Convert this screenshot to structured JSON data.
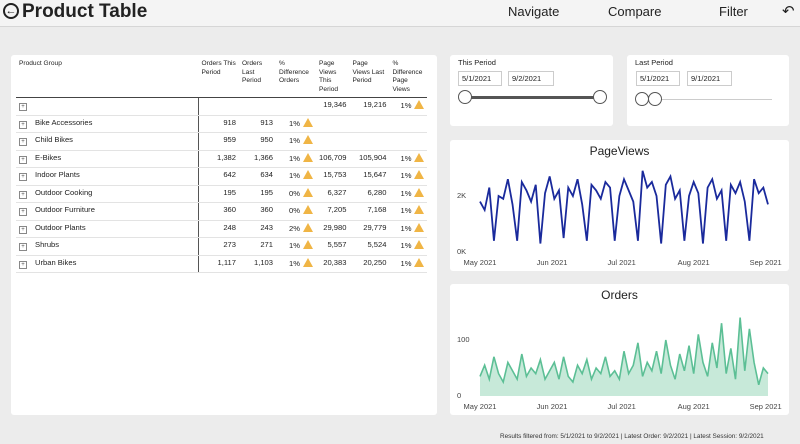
{
  "header": {
    "back_icon": "back-arrow-circle-icon",
    "title": "Product Table",
    "nav": [
      "Navigate",
      "Compare",
      "Filter"
    ],
    "undo_icon": "undo-arrow-icon"
  },
  "table": {
    "headers": [
      "Product Group",
      "Orders This Period",
      "Orders Last Period",
      "% Difference Orders",
      "Page Views This Period",
      "Page Views Last Period",
      "% Difference Page Views"
    ],
    "rows": [
      {
        "name": "",
        "o_this": "",
        "o_last": "",
        "o_diff": "",
        "o_warn": false,
        "pv_this": "19,346",
        "pv_last": "19,216",
        "pv_diff": "1%",
        "pv_warn": true
      },
      {
        "name": "Bike Accessories",
        "o_this": "918",
        "o_last": "913",
        "o_diff": "1%",
        "o_warn": true,
        "pv_this": "",
        "pv_last": "",
        "pv_diff": "",
        "pv_warn": false
      },
      {
        "name": "Child Bikes",
        "o_this": "959",
        "o_last": "950",
        "o_diff": "1%",
        "o_warn": true,
        "pv_this": "",
        "pv_last": "",
        "pv_diff": "",
        "pv_warn": false
      },
      {
        "name": "E-Bikes",
        "o_this": "1,382",
        "o_last": "1,366",
        "o_diff": "1%",
        "o_warn": true,
        "pv_this": "106,709",
        "pv_last": "105,904",
        "pv_diff": "1%",
        "pv_warn": true
      },
      {
        "name": "Indoor Plants",
        "o_this": "642",
        "o_last": "634",
        "o_diff": "1%",
        "o_warn": true,
        "pv_this": "15,753",
        "pv_last": "15,647",
        "pv_diff": "1%",
        "pv_warn": true
      },
      {
        "name": "Outdoor Cooking",
        "o_this": "195",
        "o_last": "195",
        "o_diff": "0%",
        "o_warn": true,
        "pv_this": "6,327",
        "pv_last": "6,280",
        "pv_diff": "1%",
        "pv_warn": true
      },
      {
        "name": "Outdoor Furniture",
        "o_this": "360",
        "o_last": "360",
        "o_diff": "0%",
        "o_warn": true,
        "pv_this": "7,205",
        "pv_last": "7,168",
        "pv_diff": "1%",
        "pv_warn": true
      },
      {
        "name": "Outdoor Plants",
        "o_this": "248",
        "o_last": "243",
        "o_diff": "2%",
        "o_warn": true,
        "pv_this": "29,980",
        "pv_last": "29,779",
        "pv_diff": "1%",
        "pv_warn": true
      },
      {
        "name": "Shrubs",
        "o_this": "273",
        "o_last": "271",
        "o_diff": "1%",
        "o_warn": true,
        "pv_this": "5,557",
        "pv_last": "5,524",
        "pv_diff": "1%",
        "pv_warn": true
      },
      {
        "name": "Urban Bikes",
        "o_this": "1,117",
        "o_last": "1,103",
        "o_diff": "1%",
        "o_warn": true,
        "pv_this": "20,383",
        "pv_last": "20,250",
        "pv_diff": "1%",
        "pv_warn": true
      }
    ]
  },
  "this_period": {
    "label": "This Period",
    "start": "5/1/2021",
    "end": "9/2/2021",
    "range_fraction": [
      0,
      1
    ]
  },
  "last_period": {
    "label": "Last Period",
    "start": "5/1/2021",
    "end": "9/1/2021",
    "range_fraction": [
      0,
      0.1
    ]
  },
  "colors": {
    "pageviews_line": "#1a2a9c",
    "orders_line": "#5cbf95",
    "orders_fill": "#c7e9d9",
    "warning": "#f0b545",
    "slider_track": "#555555"
  },
  "chart_data": [
    {
      "type": "line",
      "title": "PageViews",
      "xlabel": "",
      "ylabel": "",
      "x_ticks": [
        "May 2021",
        "Jun 2021",
        "Jul 2021",
        "Aug 2021",
        "Sep 2021"
      ],
      "y_ticks": [
        "0K",
        "2K"
      ],
      "ylim": [
        0,
        3000
      ],
      "x": [
        "2021-05-01",
        "2021-05-03",
        "2021-05-05",
        "2021-05-07",
        "2021-05-09",
        "2021-05-11",
        "2021-05-13",
        "2021-05-15",
        "2021-05-17",
        "2021-05-19",
        "2021-05-21",
        "2021-05-23",
        "2021-05-25",
        "2021-05-27",
        "2021-05-29",
        "2021-05-31",
        "2021-06-02",
        "2021-06-04",
        "2021-06-06",
        "2021-06-08",
        "2021-06-10",
        "2021-06-12",
        "2021-06-14",
        "2021-06-16",
        "2021-06-18",
        "2021-06-20",
        "2021-06-22",
        "2021-06-24",
        "2021-06-26",
        "2021-06-28",
        "2021-06-30",
        "2021-07-02",
        "2021-07-04",
        "2021-07-06",
        "2021-07-08",
        "2021-07-10",
        "2021-07-12",
        "2021-07-14",
        "2021-07-16",
        "2021-07-18",
        "2021-07-20",
        "2021-07-22",
        "2021-07-24",
        "2021-07-26",
        "2021-07-28",
        "2021-07-30",
        "2021-08-01",
        "2021-08-03",
        "2021-08-05",
        "2021-08-07",
        "2021-08-09",
        "2021-08-11",
        "2021-08-13",
        "2021-08-15",
        "2021-08-17",
        "2021-08-19",
        "2021-08-21",
        "2021-08-23",
        "2021-08-25",
        "2021-08-27",
        "2021-08-29",
        "2021-08-31",
        "2021-09-02"
      ],
      "series": [
        {
          "values": [
            1800,
            1500,
            2300,
            400,
            2000,
            1900,
            2600,
            1700,
            400,
            2500,
            2200,
            1800,
            2400,
            300,
            2100,
            2700,
            1900,
            2200,
            500,
            2300,
            2000,
            2600,
            1700,
            400,
            2400,
            2200,
            1900,
            2500,
            2300,
            400,
            2000,
            2600,
            2200,
            1800,
            400,
            2900,
            2300,
            2500,
            2000,
            300,
            2400,
            2700,
            1900,
            2200,
            400,
            2000,
            2500,
            2100,
            300,
            2300,
            2600,
            1900,
            2200,
            400,
            2400,
            2100,
            2500,
            1800,
            400,
            2600,
            2100,
            2300,
            1700
          ]
        }
      ]
    },
    {
      "type": "area",
      "title": "Orders",
      "xlabel": "",
      "ylabel": "",
      "x_ticks": [
        "May 2021",
        "Jun 2021",
        "Jul 2021",
        "Aug 2021",
        "Sep 2021"
      ],
      "y_ticks": [
        "0",
        "100"
      ],
      "ylim": [
        0,
        150
      ],
      "x": [
        "2021-05-01",
        "2021-05-03",
        "2021-05-05",
        "2021-05-07",
        "2021-05-09",
        "2021-05-11",
        "2021-05-13",
        "2021-05-15",
        "2021-05-17",
        "2021-05-19",
        "2021-05-21",
        "2021-05-23",
        "2021-05-25",
        "2021-05-27",
        "2021-05-29",
        "2021-05-31",
        "2021-06-02",
        "2021-06-04",
        "2021-06-06",
        "2021-06-08",
        "2021-06-10",
        "2021-06-12",
        "2021-06-14",
        "2021-06-16",
        "2021-06-18",
        "2021-06-20",
        "2021-06-22",
        "2021-06-24",
        "2021-06-26",
        "2021-06-28",
        "2021-06-30",
        "2021-07-02",
        "2021-07-04",
        "2021-07-06",
        "2021-07-08",
        "2021-07-10",
        "2021-07-12",
        "2021-07-14",
        "2021-07-16",
        "2021-07-18",
        "2021-07-20",
        "2021-07-22",
        "2021-07-24",
        "2021-07-26",
        "2021-07-28",
        "2021-07-30",
        "2021-08-01",
        "2021-08-03",
        "2021-08-05",
        "2021-08-07",
        "2021-08-09",
        "2021-08-11",
        "2021-08-13",
        "2021-08-15",
        "2021-08-17",
        "2021-08-19",
        "2021-08-21",
        "2021-08-23",
        "2021-08-25",
        "2021-08-27",
        "2021-08-29",
        "2021-08-31",
        "2021-09-02"
      ],
      "series": [
        {
          "values": [
            35,
            55,
            30,
            70,
            40,
            25,
            60,
            45,
            30,
            75,
            35,
            50,
            40,
            65,
            30,
            45,
            60,
            30,
            70,
            35,
            25,
            55,
            40,
            65,
            30,
            50,
            40,
            70,
            35,
            45,
            30,
            80,
            40,
            55,
            95,
            35,
            60,
            45,
            80,
            40,
            100,
            55,
            30,
            75,
            45,
            90,
            40,
            110,
            60,
            35,
            95,
            50,
            130,
            40,
            85,
            30,
            140,
            45,
            120,
            60,
            20,
            50,
            40
          ]
        }
      ]
    }
  ],
  "footer": {
    "text": "Results filtered from: 5/1/2021 to 9/2/2021  |  Latest Order: 9/2/2021  |  Latest Session: 9/2/2021"
  }
}
